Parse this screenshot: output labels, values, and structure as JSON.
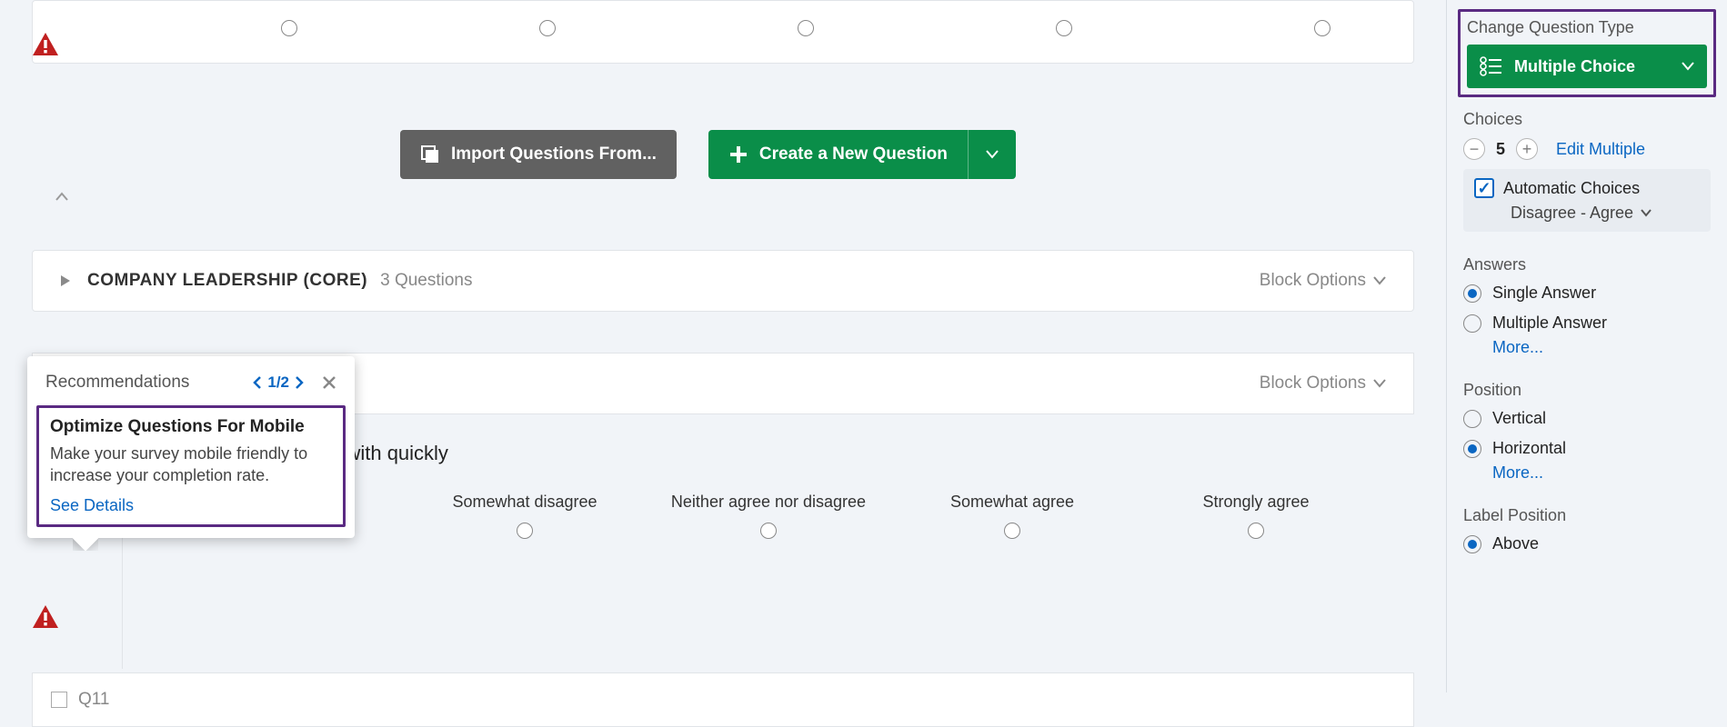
{
  "top_radio_count": 5,
  "actions": {
    "import_label": "Import Questions From...",
    "create_label": "Create a New Question"
  },
  "block1": {
    "title": "COMPANY LEADERSHIP (CORE)",
    "count": "3 Questions",
    "options_label": "Block Options"
  },
  "block2": {
    "options_label": "Block Options"
  },
  "question": {
    "text_suffix": "d concerns are dealt with quickly",
    "choices": [
      "Somewhat disagree",
      "Neither agree nor disagree",
      "Somewhat agree",
      "Strongly agree"
    ]
  },
  "recommendations": {
    "title": "Recommendations",
    "page": "1/2",
    "card_title": "Optimize Questions For Mobile",
    "card_desc": "Make your survey mobile friendly to increase your completion rate.",
    "see_details": "See Details"
  },
  "sidebar": {
    "change_type_label": "Change Question Type",
    "qtype": "Multiple Choice",
    "choices_header": "Choices",
    "choices_count": "5",
    "edit_multiple": "Edit Multiple",
    "auto_choices": "Automatic Choices",
    "auto_scale": "Disagree - Agree",
    "answers_header": "Answers",
    "answers_single": "Single Answer",
    "answers_multiple": "Multiple Answer",
    "position_header": "Position",
    "position_vertical": "Vertical",
    "position_horizontal": "Horizontal",
    "label_position_header": "Label Position",
    "label_above": "Above",
    "more": "More..."
  },
  "next_q_id": "Q11"
}
